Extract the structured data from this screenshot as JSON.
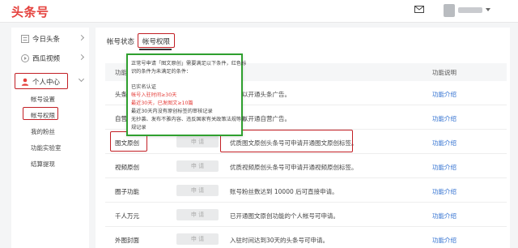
{
  "header": {
    "logo": "头条号"
  },
  "sidebar": {
    "items": [
      {
        "label": "今日头条"
      },
      {
        "label": "西瓜视频"
      },
      {
        "label": "个人中心"
      }
    ],
    "sub_items": [
      {
        "label": "帐号设置"
      },
      {
        "label": "帐号权限"
      },
      {
        "label": "我的粉丝"
      },
      {
        "label": "功能实验室"
      },
      {
        "label": "结算提现"
      }
    ]
  },
  "tabs": [
    {
      "label": "帐号状态"
    },
    {
      "label": "帐号权限"
    }
  ],
  "table": {
    "headers": {
      "function": "功能",
      "description": "功能说明"
    },
    "apply_label": "申 请",
    "rows": [
      {
        "name": "头条广告",
        "description": "号可以开通头条广告。",
        "link": "功能介绍"
      },
      {
        "name": "自营广告",
        "description": "号可以开通自营广告。",
        "link": "功能介绍"
      },
      {
        "name": "图文原创",
        "description": "优质图文原创头条号可申请开通图文原创标签。",
        "link": "功能介绍"
      },
      {
        "name": "视频原创",
        "description": "优质视频原创头条号可申请开通视频原创标签。",
        "link": "功能介绍"
      },
      {
        "name": "圈子功能",
        "description": "账号粉丝数达到 10000 后可直接申请。",
        "link": "功能介绍"
      },
      {
        "name": "千人万元",
        "description": "已开通图文原创功能的个人帐号可申请。",
        "link": "功能介绍"
      },
      {
        "name": "外图封面",
        "description": "入驻时间达到30天的头条号可申请。",
        "link": "功能介绍"
      }
    ]
  },
  "tooltip": {
    "lines": [
      {
        "text": "正常号申请「图文原创」需要满足以下条件，红色标",
        "red": false
      },
      {
        "text": "识的条件为未满足的条件：",
        "red": false
      },
      {
        "text": "",
        "red": false
      },
      {
        "text": "已实名认证",
        "red": false
      },
      {
        "text": "帐号入驻时间≥30天",
        "red": true
      },
      {
        "text": "最近30天，已发图文≥10篇",
        "red": true
      },
      {
        "text": "最近30天内没有原创标签的审核记录",
        "red": false
      },
      {
        "text": "无抄袭、发布不雅内容、违反国家有关政策法规等违",
        "red": false
      },
      {
        "text": "规记录",
        "red": false
      }
    ]
  },
  "colors": {
    "brand": "#e5413d",
    "highlight_box": "#c21f25",
    "tooltip_border": "#2fa02f",
    "link": "#2f6fd0"
  }
}
